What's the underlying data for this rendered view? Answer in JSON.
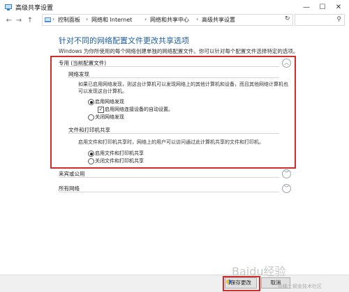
{
  "window": {
    "title": "高级共享设置",
    "minimize": "—",
    "maximize": "☐",
    "close": "✕"
  },
  "nav": {
    "back": "←",
    "forward": "→",
    "up": "↑",
    "breadcrumbs": [
      "控制面板",
      "网络和 Internet",
      "网络和共享中心",
      "高级共享设置"
    ],
    "separator": "›",
    "refresh": "↻",
    "search_icon": "⚲"
  },
  "main": {
    "heading": "针对不同的网络配置文件更改共享选项",
    "subtext": "Windows 为你所使用的每个网络创建单独的网络配置文件。你可以针对每个配置文件选择特定的选项。"
  },
  "profiles": {
    "private": {
      "title": "专用 (当前配置文件)",
      "chevron": "︿",
      "discovery": {
        "title": "网络发现",
        "desc_line1": "如果已启用网络发现，则这台计算机可以发现网络上的其他计算机和设备，而且其他网络计算机也",
        "desc_line2": "可以发现这台计算机。",
        "opt_on": "启用网络发现",
        "opt_auto": "启用网络连接设备的自动设置。",
        "opt_off": "关闭网络发现",
        "check_mark": "✓"
      },
      "sharing": {
        "title": "文件和打印机共享",
        "desc": "启用文件和打印机共享时，网络上的用户可以访问通过此计算机共享的文件和打印机。",
        "opt_on": "启用文件和打印机共享",
        "opt_off": "关闭文件和打印机共享"
      }
    },
    "guest": {
      "title": "来宾或公用",
      "chevron": "﹀"
    },
    "all": {
      "title": "所有网络",
      "chevron": "﹀"
    }
  },
  "footer": {
    "save": "保存更改",
    "cancel": "取消"
  },
  "watermark": {
    "main": "Baidu经验",
    "sub": "@稀土掘金技术社区"
  },
  "colors": {
    "heading": "#1f5fa5",
    "highlight": "#d32a2a"
  }
}
